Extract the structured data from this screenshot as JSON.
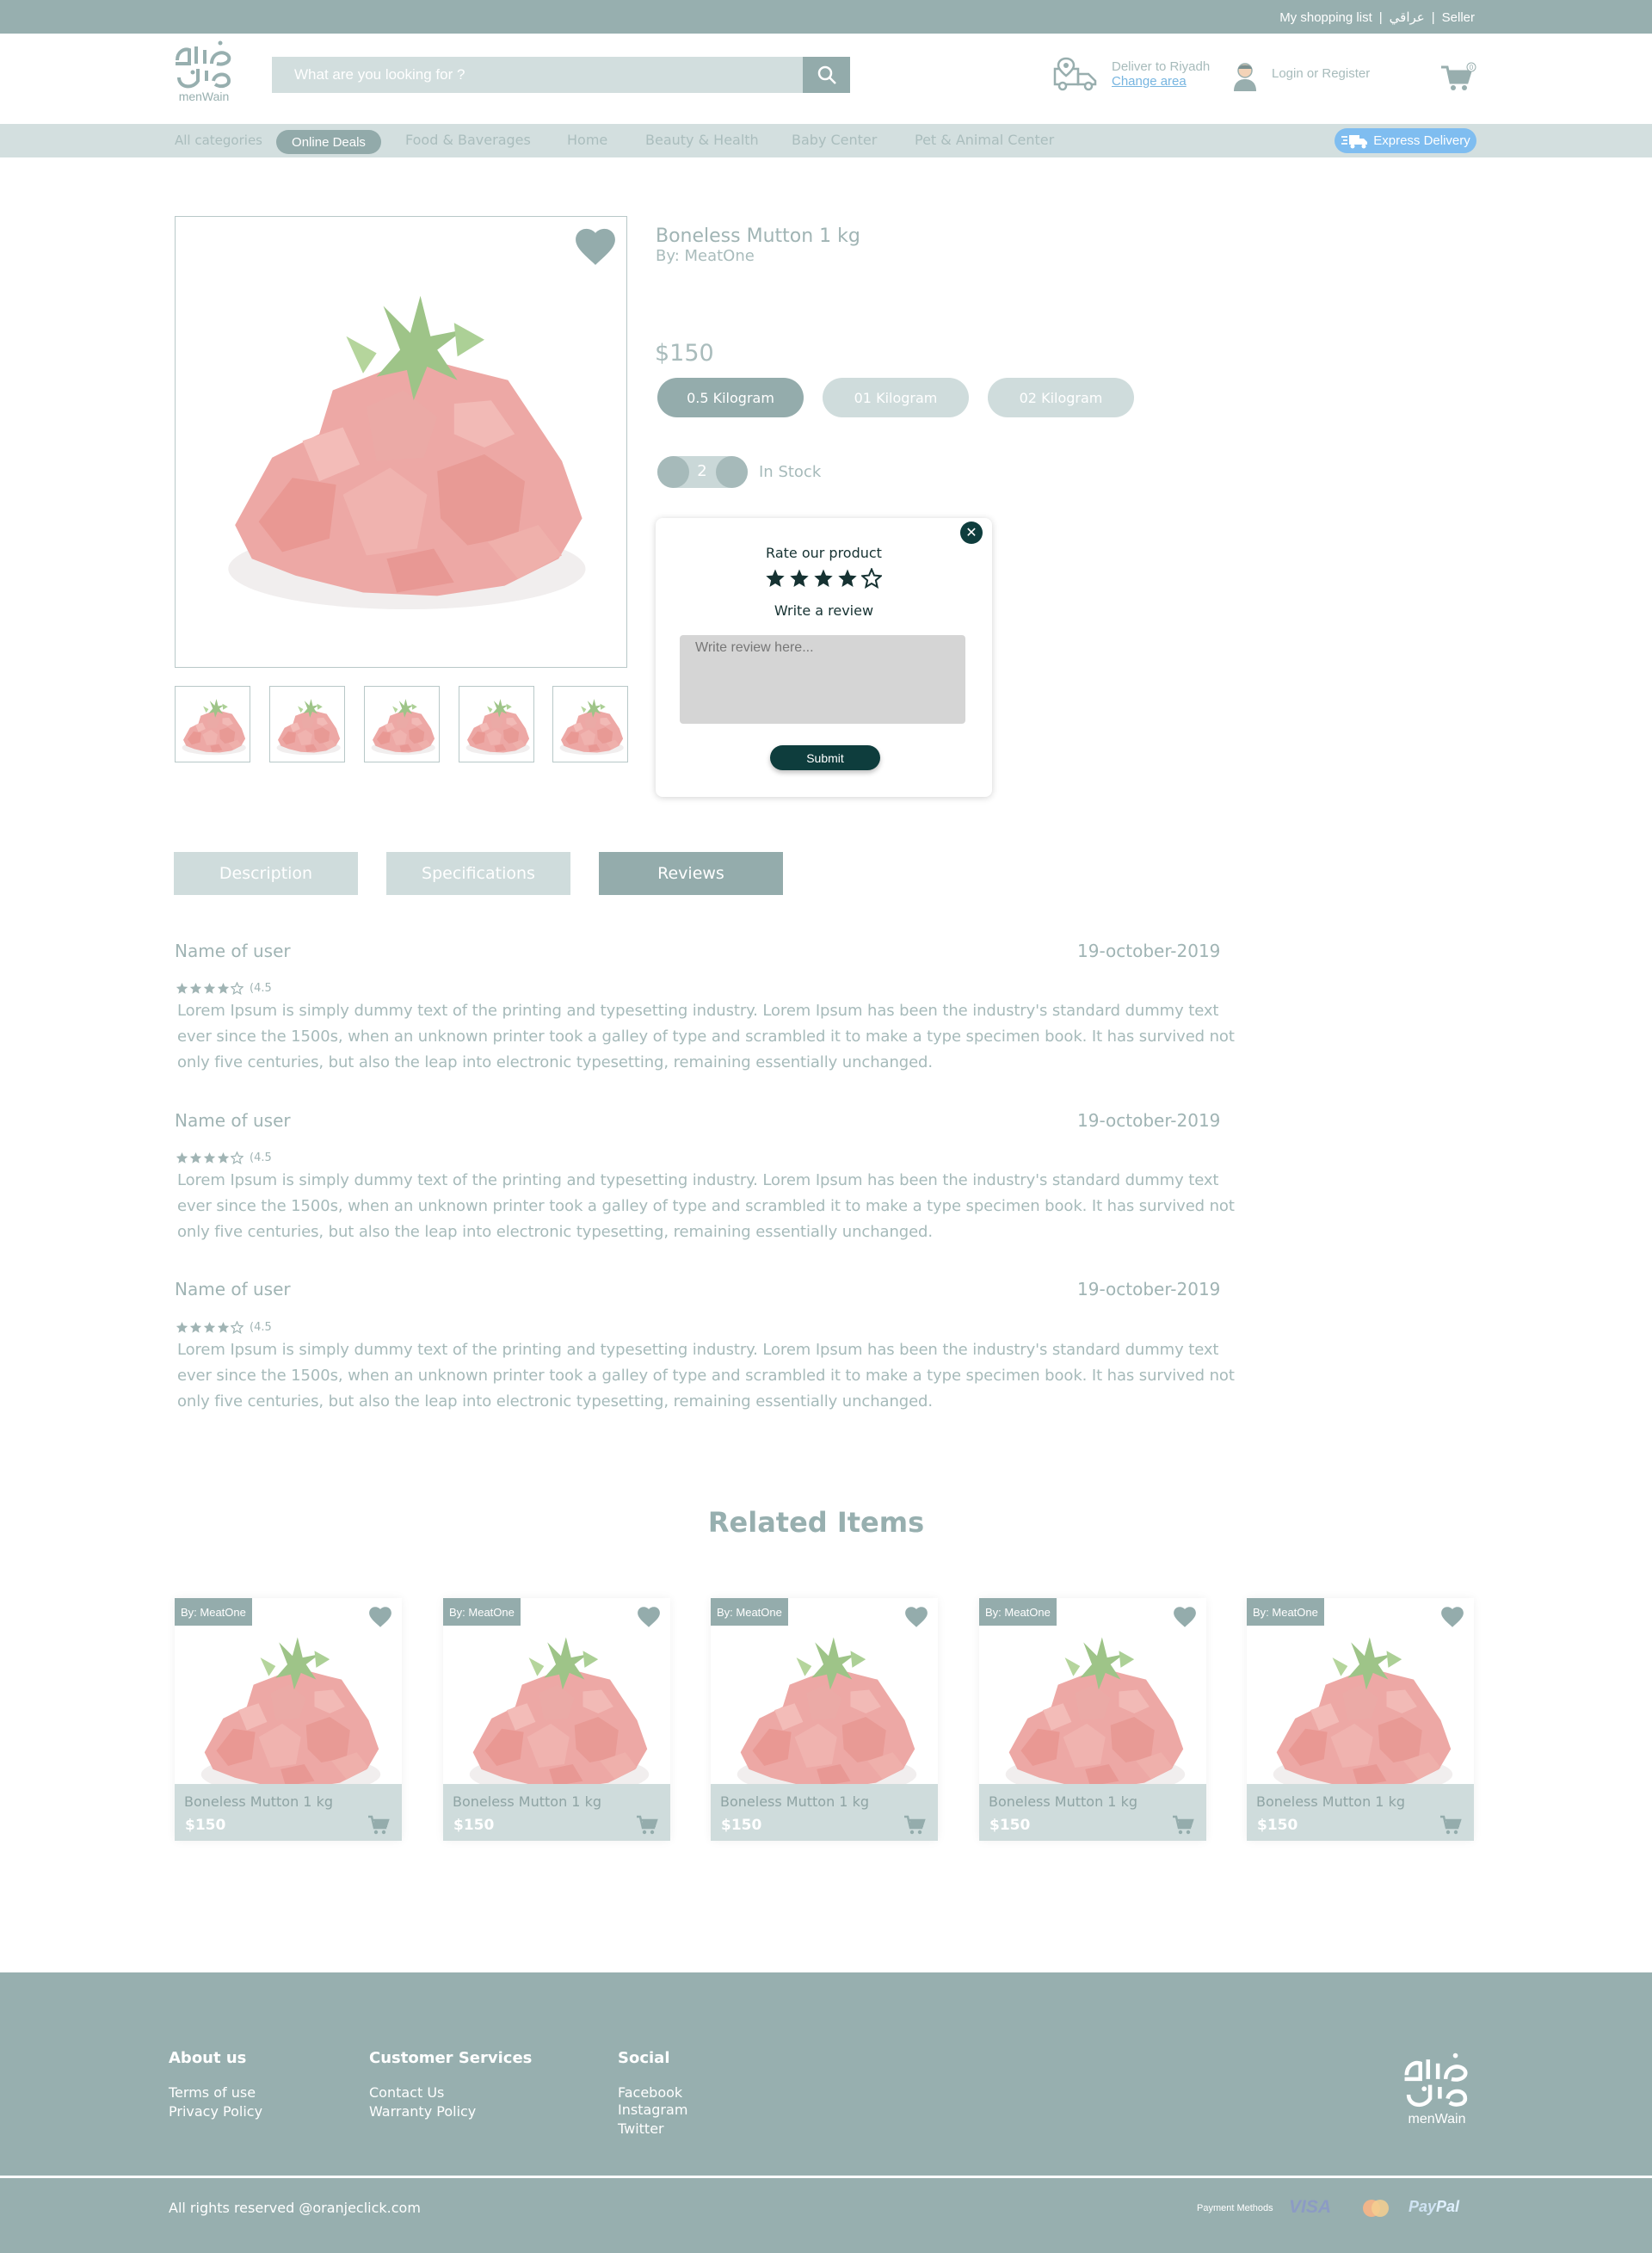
{
  "topbar": {
    "links": [
      "My shopping list",
      "|",
      "عراقي",
      "|",
      "Seller"
    ]
  },
  "header": {
    "logo_text": "menWain",
    "search_placeholder": "What are you looking for ?",
    "deliver_to": "Deliver to Riyadh",
    "change_area": "Change area",
    "login": "Login or Register",
    "cart_count": "0"
  },
  "nav": {
    "items": [
      "All categories",
      "Online Deals",
      "Food & Baverages",
      "Home",
      "Beauty & Health",
      "Baby Center",
      "Pet & Animal Center"
    ],
    "express": "Express Delivery"
  },
  "product": {
    "title": "Boneless Mutton 1 kg",
    "brand": "By: MeatOne",
    "price": "$150",
    "sizes": [
      "0.5 Kilogram",
      "01 Kilogram",
      "02 Kilogram"
    ],
    "selected_size": "0.5 Kilogram",
    "quantity": "2",
    "stock": "In Stock"
  },
  "rating_popup": {
    "title": "Rate our product",
    "stars_filled": 4,
    "stars_total": 5,
    "subtitle": "Write a review",
    "placeholder": "Write review here...",
    "submit": "Submit"
  },
  "tabs": [
    "Description",
    "Specifications",
    "Reviews"
  ],
  "active_tab": "Reviews",
  "reviews": [
    {
      "name": "Name of user",
      "date": "19-october-2019",
      "score": "(4.5",
      "text": "Lorem Ipsum is simply dummy text of the printing and typesetting industry. Lorem Ipsum has been the industry's standard dummy text ever since the 1500s, when an unknown printer took a galley of type and scrambled it to make a type specimen book. It has survived not only five centuries, but also the leap into electronic typesetting, remaining essentially unchanged."
    },
    {
      "name": "Name of user",
      "date": "19-october-2019",
      "score": "(4.5",
      "text": "Lorem Ipsum is simply dummy text of the printing and typesetting industry. Lorem Ipsum has been the industry's standard dummy text ever since the 1500s, when an unknown printer took a galley of type and scrambled it to make a type specimen book. It has survived not only five centuries, but also the leap into electronic typesetting, remaining essentially unchanged."
    },
    {
      "name": "Name of user",
      "date": "19-october-2019",
      "score": "(4.5",
      "text": "Lorem Ipsum is simply dummy text of the printing and typesetting industry. Lorem Ipsum has been the industry's standard dummy text ever since the 1500s, when an unknown printer took a galley of type and scrambled it to make a type specimen book. It has survived not only five centuries, but also the leap into electronic typesetting, remaining essentially unchanged."
    }
  ],
  "related": {
    "title": "Related Items",
    "items": [
      {
        "brand": "By: MeatOne",
        "name": "Boneless Mutton 1 kg",
        "price": "$150"
      },
      {
        "brand": "By: MeatOne",
        "name": "Boneless Mutton 1 kg",
        "price": "$150"
      },
      {
        "brand": "By: MeatOne",
        "name": "Boneless Mutton 1 kg",
        "price": "$150"
      },
      {
        "brand": "By: MeatOne",
        "name": "Boneless Mutton 1 kg",
        "price": "$150"
      },
      {
        "brand": "By: MeatOne",
        "name": "Boneless Mutton 1 kg",
        "price": "$150"
      }
    ]
  },
  "footer": {
    "about": {
      "title": "About us",
      "links": [
        "Terms of use",
        "Privacy Policy"
      ]
    },
    "customer": {
      "title": "Customer Services",
      "links": [
        "Contact Us",
        "Warranty Policy"
      ]
    },
    "social": {
      "title": "Social",
      "links": [
        "Facebook",
        "Instagram",
        "Twitter"
      ]
    },
    "logo_text": "menWain",
    "copyright": "All rights reserved @oranjeclick.com",
    "payment_label": "Payment Methods",
    "payments": [
      "VISA",
      "Pay",
      "Pal"
    ]
  },
  "colors": {
    "primary": "#97afaf",
    "light": "#cfdcdc",
    "dark": "#0e3d3d",
    "express": "#7fbdf0"
  }
}
